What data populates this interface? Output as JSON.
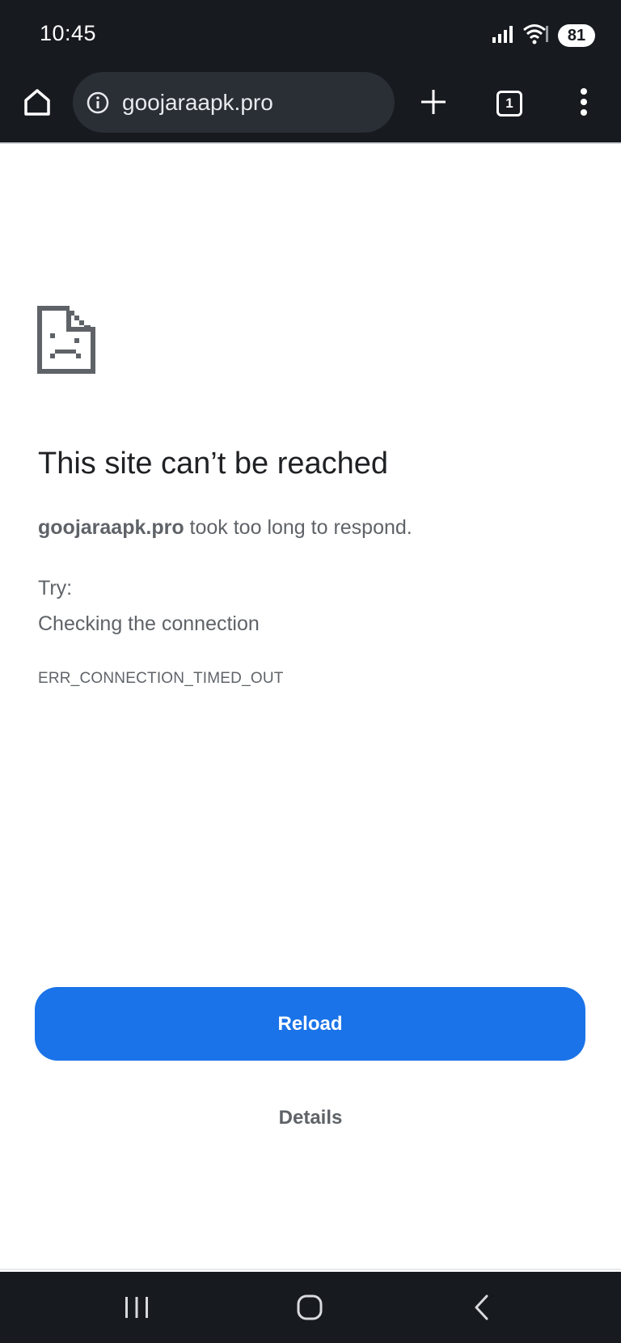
{
  "status_bar": {
    "time": "10:45",
    "battery_level": "81",
    "icons": [
      "signal-icon",
      "wifi-icon",
      "battery-icon"
    ]
  },
  "browser": {
    "url": "goojaraapk.pro",
    "tab_count": "1",
    "icons": {
      "home": "home-icon",
      "site_info": "info-icon",
      "new_tab": "plus-icon",
      "menu": "kebab-menu-icon"
    }
  },
  "error_page": {
    "icon": "sad-document-icon",
    "heading": "This site can’t be reached",
    "host": "goojaraapk.pro",
    "message": " took too long to respond.",
    "try_label": "Try:",
    "suggestion": "Checking the connection",
    "error_code": "ERR_CONNECTION_TIMED_OUT",
    "reload_label": "Reload",
    "details_label": "Details"
  },
  "nav_bar": {
    "icons": [
      "recents-icon",
      "home-nav-icon",
      "back-icon"
    ]
  },
  "colors": {
    "chrome_bg": "#171a1f",
    "omnibox_bg": "#2a2e35",
    "primary_button": "#1a73e8",
    "text_primary": "#202124",
    "text_secondary": "#5f6368"
  }
}
